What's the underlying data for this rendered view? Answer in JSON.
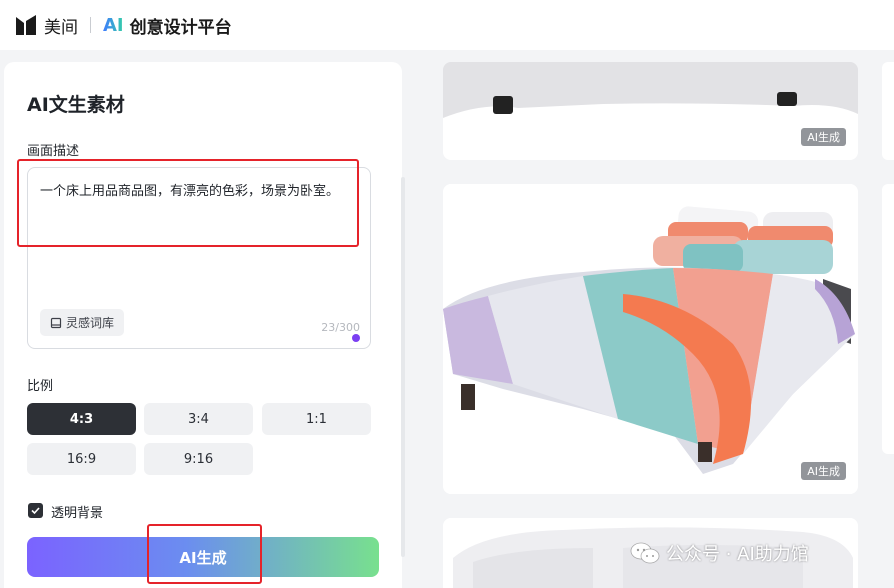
{
  "header": {
    "brand_name": "美间",
    "ai_label": "AI",
    "platform_name": "创意设计平台"
  },
  "panel": {
    "title": "AI文生素材",
    "description_label": "画面描述",
    "prompt_text": "一个床上用品商品图，有漂亮的色彩，场景为卧室。",
    "inspiration_button": "灵感词库",
    "char_count": "23/300",
    "ratio_label": "比例",
    "ratios": [
      {
        "label": "4:3",
        "selected": true
      },
      {
        "label": "3:4",
        "selected": false
      },
      {
        "label": "1:1",
        "selected": false
      },
      {
        "label": "16:9",
        "selected": false
      },
      {
        "label": "9:16",
        "selected": false
      }
    ],
    "transparent_bg_label": "透明背景",
    "transparent_bg_checked": true,
    "generate_button": "AI生成"
  },
  "results": {
    "badge_label": "AI生成"
  },
  "watermark": {
    "text": "公众号 · AI助力馆"
  },
  "colors": {
    "accent_purple": "#7b3ff2",
    "annotation_red": "#e5232a",
    "dark_button": "#2d3036"
  }
}
